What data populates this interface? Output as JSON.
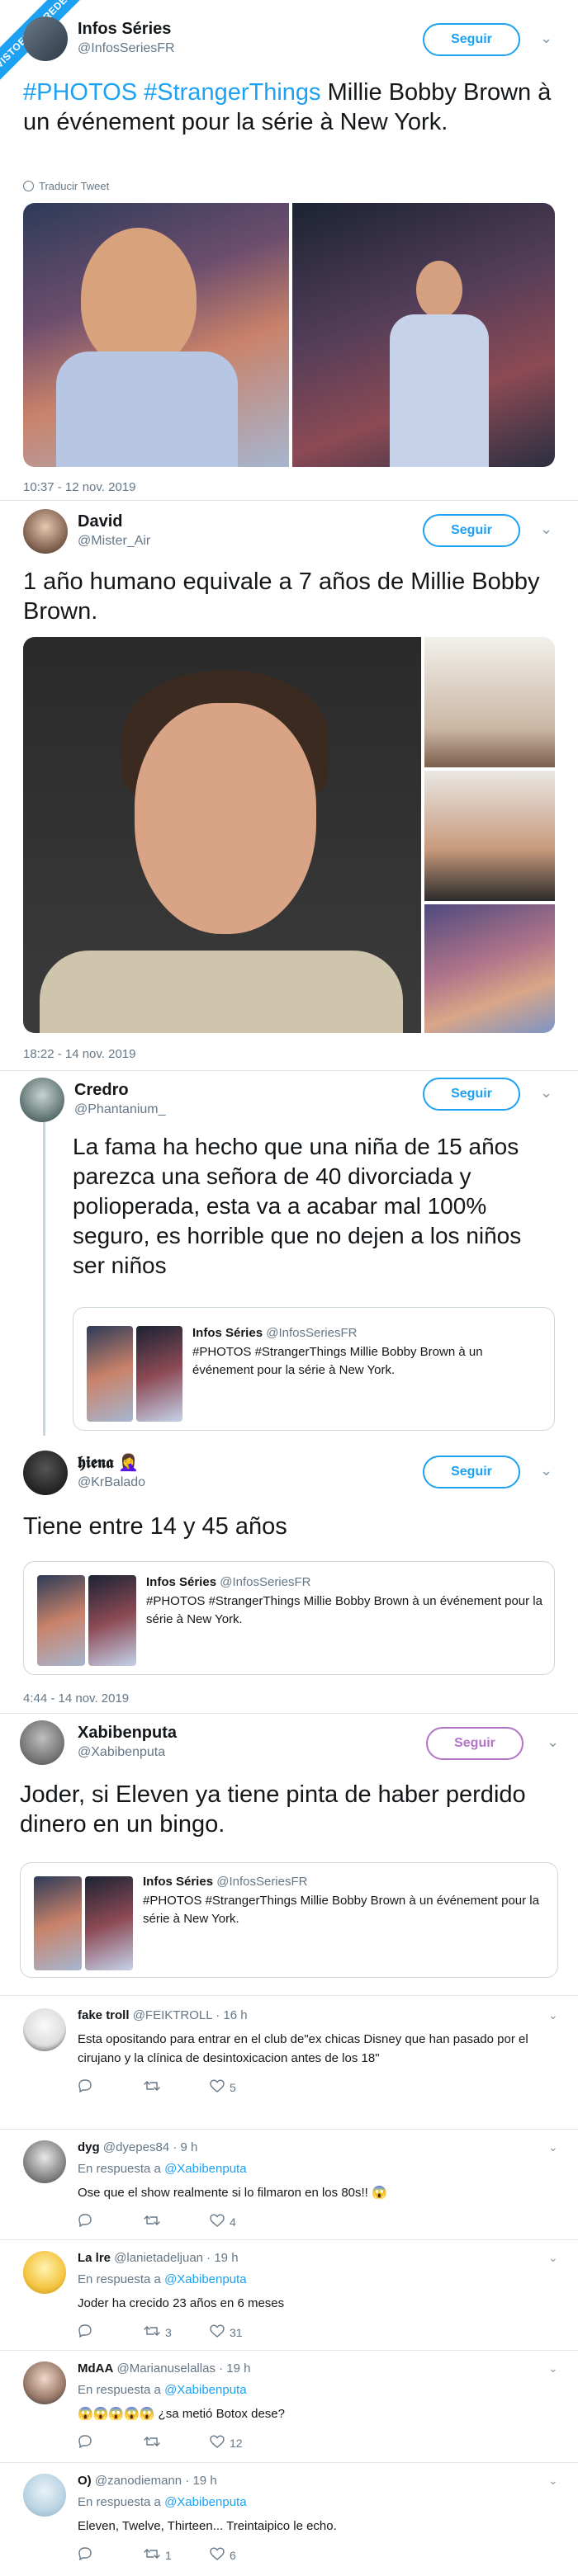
{
  "watermark": "VISTOENLASREDES",
  "t1": {
    "name": "Infos Séries",
    "handle": "@InfosSeriesFR",
    "follow": "Seguir",
    "hashtag1": "#PHOTOS",
    "hashtag2": "#StrangerThings",
    "text": " Millie Bobby Brown à un événement pour la série à New York.",
    "translate": "Traducir Tweet",
    "timestamp": "10:37 - 12 nov. 2019"
  },
  "t2": {
    "name": "David",
    "handle": "@Mister_Air",
    "follow": "Seguir",
    "text": "1 año humano equivale a 7 años de Millie Bobby Brown.",
    "timestamp": "18:22 - 14 nov. 2019"
  },
  "t3": {
    "name": "Credro",
    "handle": "@Phantanium_",
    "follow": "Seguir",
    "text": "La fama ha hecho que una niña de 15 años parezca una señora de 40 divorciada y polioperada, esta va a acabar mal 100% seguro, es horrible que no dejen a los niños ser niños",
    "quote": {
      "name": "Infos Séries",
      "handle": "@InfosSeriesFR",
      "text": "#PHOTOS #StrangerThings Millie Bobby Brown à un événement pour la série à New York."
    }
  },
  "t4": {
    "name": "𝖍𝖎𝖊𝖓𝖆",
    "emoji": "🤦‍♀️",
    "handle": "@KrBalado",
    "follow": "Seguir",
    "text": "Tiene entre 14 y 45 años",
    "quote": {
      "name": "Infos Séries",
      "handle": "@InfosSeriesFR",
      "text": "#PHOTOS #StrangerThings Millie Bobby Brown à un événement pour la série à New York."
    },
    "timestamp": "4:44 - 14 nov. 2019"
  },
  "t5": {
    "name": "Xabibenputa",
    "handle": "@Xabibenputa",
    "follow": "Seguir",
    "text": "Joder, si Eleven ya tiene pinta de haber perdido dinero en un bingo.",
    "quote": {
      "name": "Infos Séries",
      "handle": "@InfosSeriesFR",
      "text": "#PHOTOS #StrangerThings Millie Bobby Brown à un événement pour la série à New York."
    }
  },
  "replies": [
    {
      "name": "fake troll",
      "meta": "@FEIKTROLL · 16 h",
      "in_reply_prefix": "En respuesta a",
      "in_reply_to": "@Xabibenputa",
      "text": "Esta opositando para entrar en el club de\"ex chicas Disney que han pasado por el cirujano y la clínica de desintoxicacion antes de los 18\"",
      "retweets": "",
      "likes": "5"
    },
    {
      "name": "dyg",
      "meta": "@dyepes84 · 9 h",
      "in_reply_prefix": "En respuesta a",
      "in_reply_to": "@Xabibenputa",
      "text": "Ose que el show realmente si lo filmaron en los 80s!! 😱",
      "retweets": "",
      "likes": "4"
    },
    {
      "name": "La lre",
      "meta": "@lanietadeljuan · 19 h",
      "in_reply_prefix": "En respuesta a",
      "in_reply_to": "@Xabibenputa",
      "text": "Joder ha crecido 23 años en 6 meses",
      "retweets": "3",
      "likes": "31"
    },
    {
      "name": "MdAA",
      "meta": "@Marianuselallas · 19 h",
      "in_reply_prefix": "En respuesta a",
      "in_reply_to": "@Xabibenputa",
      "text": "😱😱😱😱😱 ¿sa metió Botox dese?",
      "retweets": "",
      "likes": "12"
    },
    {
      "name": "O)",
      "meta": "@zanodiemann · 19 h",
      "in_reply_prefix": "En respuesta a",
      "in_reply_to": "@Xabibenputa",
      "text": "Eleven, Twelve, Thirteen... Treintaipico le echo.",
      "retweets": "1",
      "likes": "6"
    }
  ]
}
